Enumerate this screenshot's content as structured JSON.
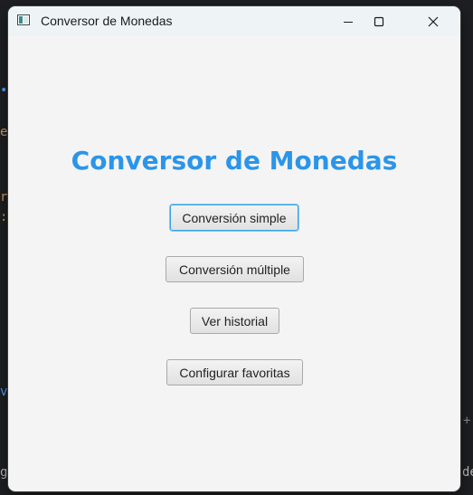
{
  "window": {
    "title": "Conversor de Monedas"
  },
  "main": {
    "heading": "Conversor de Monedas",
    "buttons": [
      {
        "label": "Conversión simple"
      },
      {
        "label": "Conversión múltiple"
      },
      {
        "label": "Ver historial"
      },
      {
        "label": "Configurar favoritas"
      }
    ]
  },
  "colors": {
    "heading": "#2b95e9",
    "focus_ring": "#3aa3df",
    "background": "#f4f4f4"
  },
  "icons": [
    "app-icon",
    "minimize-icon",
    "maximize-icon",
    "close-icon"
  ]
}
